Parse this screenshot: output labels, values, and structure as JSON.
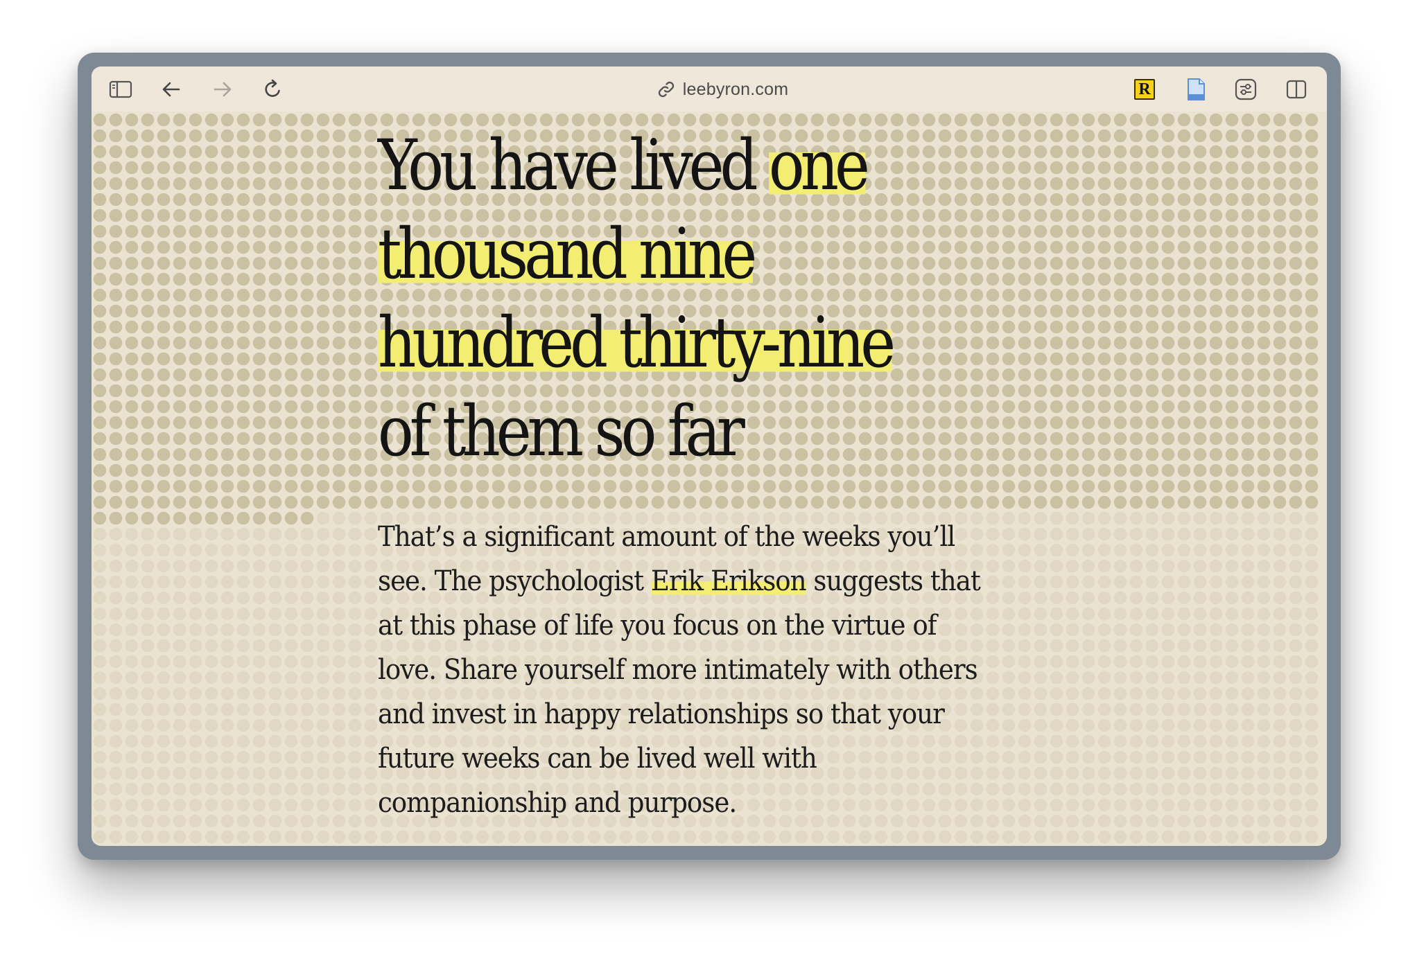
{
  "browser": {
    "url": "leebyron.com",
    "icons": {
      "sidebar": "sidebar-icon",
      "back": "back-arrow-icon",
      "forward": "forward-arrow-icon",
      "reload": "reload-icon",
      "link": "link-icon",
      "extension_r": "readwise-extension-icon",
      "document": "document-icon",
      "settings": "sliders-icon",
      "split_view": "split-view-icon"
    },
    "extension_r_label": "R"
  },
  "page": {
    "headline": {
      "prefix": "You have lived ",
      "highlight_1": "one",
      "highlight_2": "thousand nine",
      "highlight_3": "hundred thirty-nine",
      "suffix": "of them so far"
    },
    "weeks_lived": 1939,
    "body": {
      "line1": "That’s a significant amount of the weeks you’ll",
      "line2_before": "see. The psychologist ",
      "link": "Erik Erikson",
      "line2_after": " suggests that",
      "line3": "at this phase of life you focus on the virtue of",
      "line4": "love. Share yourself more intimately with others",
      "line5": "and invest in happy relationships so that your",
      "line6": "future weeks can be lived well with",
      "line7": "companionship and purpose."
    }
  },
  "colors": {
    "page_background": "#ebe3d2",
    "dot_lived": "#c9c1a2",
    "dot_future": "#e1d8c4",
    "highlight": "#f3ee72",
    "frame": "#7d8994"
  }
}
